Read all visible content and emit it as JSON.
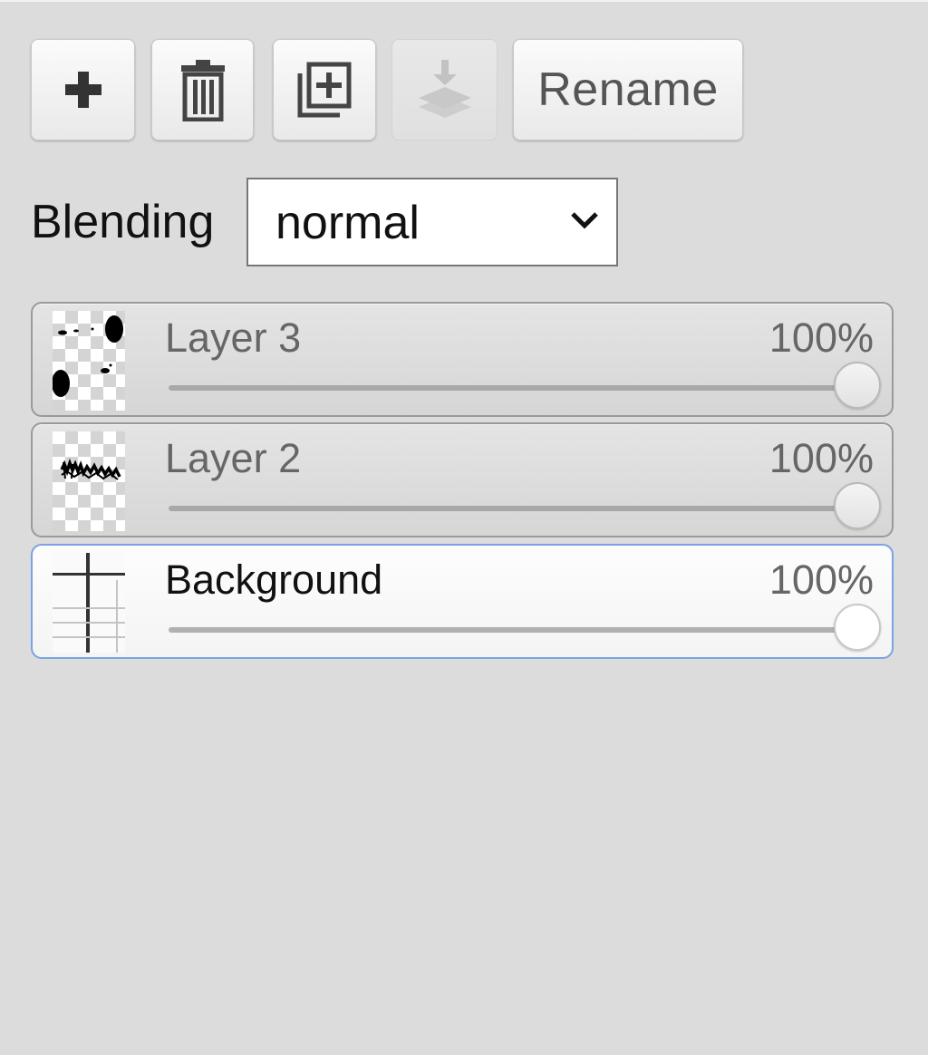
{
  "toolbar": {
    "buttons": [
      {
        "icon": "plus-icon",
        "enabled": true
      },
      {
        "icon": "trash-icon",
        "enabled": true
      },
      {
        "icon": "duplicate-icon",
        "enabled": true
      },
      {
        "icon": "merge-down-icon",
        "enabled": false
      }
    ],
    "rename_label": "Rename"
  },
  "blending": {
    "label": "Blending",
    "value": "normal"
  },
  "layers": [
    {
      "name": "Layer 3",
      "opacity_label": "100%",
      "opacity": 100,
      "active": false
    },
    {
      "name": "Layer 2",
      "opacity_label": "100%",
      "opacity": 100,
      "active": false
    },
    {
      "name": "Background",
      "opacity_label": "100%",
      "opacity": 100,
      "active": true
    }
  ],
  "colors": {
    "panel_bg": "#dcdcdc",
    "active_border": "#7aa3e6"
  }
}
